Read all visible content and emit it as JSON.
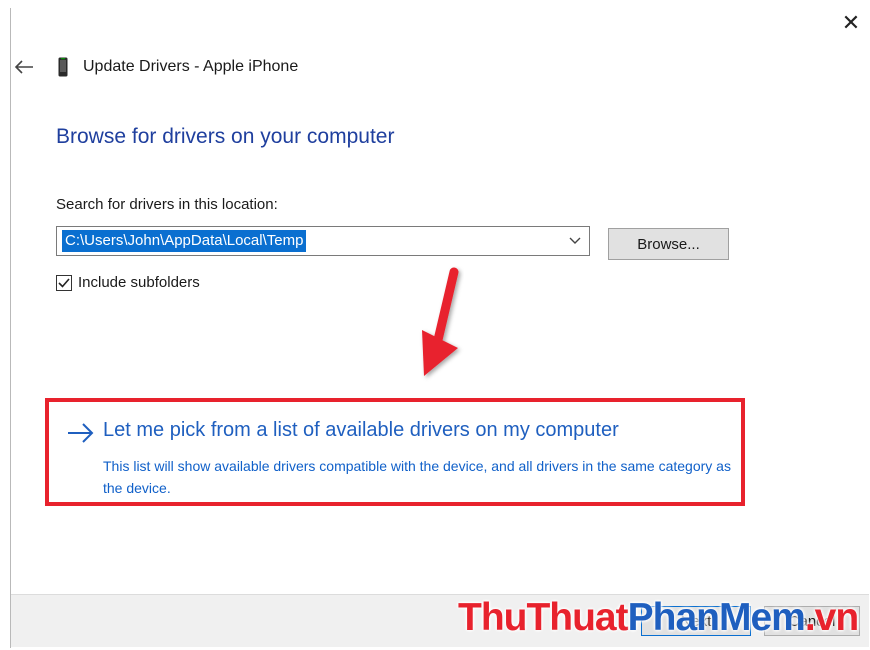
{
  "window": {
    "title": "Update Drivers - Apple iPhone",
    "close_glyph": "✕",
    "back_icon": "back-arrow-icon",
    "device_icon": "phone-icon"
  },
  "page": {
    "heading": "Browse for drivers on your computer",
    "search_label": "Search for drivers in this location:",
    "path_value": "C:\\Users\\John\\AppData\\Local\\Temp",
    "browse_label": "Browse...",
    "include_subfolders_label": "Include subfolders",
    "include_subfolders_checked": true
  },
  "pick_option": {
    "title": "Let me pick from a list of available drivers on my computer",
    "description": "This list will show available drivers compatible with the device, and all drivers in the same category as the device."
  },
  "footer": {
    "next_label": "Next",
    "cancel_label": "Cancel"
  },
  "watermark": {
    "part1": "ThuThuat",
    "part2": "PhanMem",
    "part3": ".vn"
  },
  "colors": {
    "heading": "#1f3f9e",
    "link": "#1f5fbf",
    "selection": "#0a6fd0",
    "highlight_box": "#e8222d",
    "watermark_red": "#e8222d",
    "watermark_blue": "#1f5fbf"
  }
}
